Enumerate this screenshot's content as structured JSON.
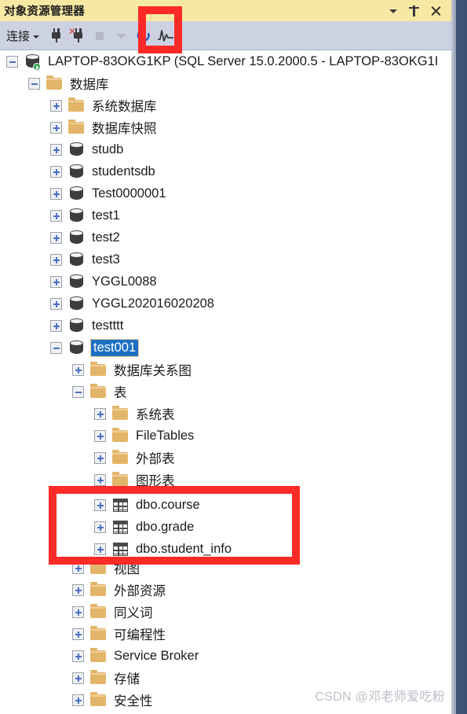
{
  "window": {
    "title": "对象资源管理器",
    "controls": [
      {
        "name": "dropdown",
        "icon": "caret-down-icon"
      },
      {
        "name": "pin",
        "icon": "pin-icon"
      },
      {
        "name": "close",
        "icon": "close-icon"
      }
    ]
  },
  "toolbar": {
    "connect_label": "连接",
    "buttons": [
      {
        "name": "connect",
        "icon": "plug-icon",
        "enabled": true
      },
      {
        "name": "disconnect",
        "icon": "plug-disconnect-icon",
        "enabled": true
      },
      {
        "name": "stop",
        "icon": "stop-square-icon",
        "enabled": false
      },
      {
        "name": "filter",
        "icon": "filter-caret-icon",
        "enabled": false
      },
      {
        "name": "refresh",
        "icon": "refresh-icon",
        "enabled": true
      },
      {
        "name": "activity-monitor",
        "icon": "activity-monitor-icon",
        "enabled": true
      }
    ]
  },
  "tree": {
    "nodes": [
      {
        "label": "LAPTOP-83OKG1KP (SQL Server 15.0.2000.5 - LAPTOP-83OKG1I",
        "indent": 0,
        "icon": "server-icon",
        "state": "minus",
        "selected": false
      },
      {
        "label": "数据库",
        "indent": 1,
        "icon": "folder-icon",
        "state": "minus",
        "selected": false
      },
      {
        "label": "系统数据库",
        "indent": 2,
        "icon": "folder-icon",
        "state": "plus",
        "selected": false
      },
      {
        "label": "数据库快照",
        "indent": 2,
        "icon": "folder-icon",
        "state": "plus",
        "selected": false
      },
      {
        "label": "studb",
        "indent": 2,
        "icon": "database-icon",
        "state": "plus",
        "selected": false
      },
      {
        "label": "studentsdb",
        "indent": 2,
        "icon": "database-icon",
        "state": "plus",
        "selected": false
      },
      {
        "label": "Test0000001",
        "indent": 2,
        "icon": "database-icon",
        "state": "plus",
        "selected": false
      },
      {
        "label": "test1",
        "indent": 2,
        "icon": "database-icon",
        "state": "plus",
        "selected": false
      },
      {
        "label": "test2",
        "indent": 2,
        "icon": "database-icon",
        "state": "plus",
        "selected": false
      },
      {
        "label": "test3",
        "indent": 2,
        "icon": "database-icon",
        "state": "plus",
        "selected": false
      },
      {
        "label": "YGGL0088",
        "indent": 2,
        "icon": "database-icon",
        "state": "plus",
        "selected": false
      },
      {
        "label": "YGGL202016020208",
        "indent": 2,
        "icon": "database-icon",
        "state": "plus",
        "selected": false
      },
      {
        "label": "testttt",
        "indent": 2,
        "icon": "database-icon",
        "state": "plus",
        "selected": false
      },
      {
        "label": "test001",
        "indent": 2,
        "icon": "database-icon",
        "state": "minus",
        "selected": true
      },
      {
        "label": "数据库关系图",
        "indent": 3,
        "icon": "folder-icon",
        "state": "plus",
        "selected": false
      },
      {
        "label": "表",
        "indent": 3,
        "icon": "folder-icon",
        "state": "minus",
        "selected": false
      },
      {
        "label": "系统表",
        "indent": 4,
        "icon": "folder-icon",
        "state": "plus",
        "selected": false
      },
      {
        "label": "FileTables",
        "indent": 4,
        "icon": "folder-icon",
        "state": "plus",
        "selected": false
      },
      {
        "label": "外部表",
        "indent": 4,
        "icon": "folder-icon",
        "state": "plus",
        "selected": false
      },
      {
        "label": "图形表",
        "indent": 4,
        "icon": "folder-icon",
        "state": "plus",
        "selected": false
      },
      {
        "label": "dbo.course",
        "indent": 4,
        "icon": "table-icon",
        "state": "plus",
        "selected": false
      },
      {
        "label": "dbo.grade",
        "indent": 4,
        "icon": "table-icon",
        "state": "plus",
        "selected": false
      },
      {
        "label": "dbo.student_info",
        "indent": 4,
        "icon": "table-icon",
        "state": "plus",
        "selected": false
      },
      {
        "label": "视图",
        "indent": 3,
        "icon": "folder-icon",
        "state": "plus",
        "selected": false
      },
      {
        "label": "外部资源",
        "indent": 3,
        "icon": "folder-icon",
        "state": "plus",
        "selected": false
      },
      {
        "label": "同义词",
        "indent": 3,
        "icon": "folder-icon",
        "state": "plus",
        "selected": false
      },
      {
        "label": "可编程性",
        "indent": 3,
        "icon": "folder-icon",
        "state": "plus",
        "selected": false
      },
      {
        "label": "Service Broker",
        "indent": 3,
        "icon": "folder-icon",
        "state": "plus",
        "selected": false
      },
      {
        "label": "存储",
        "indent": 3,
        "icon": "folder-icon",
        "state": "plus",
        "selected": false
      },
      {
        "label": "安全性",
        "indent": 3,
        "icon": "folder-icon",
        "state": "plus",
        "selected": false
      }
    ]
  },
  "annotations": [
    {
      "name": "refresh-highlight",
      "color": "#fc2b28"
    },
    {
      "name": "tables-highlight",
      "color": "#fc2b28"
    }
  ],
  "watermark": {
    "text": "CSDN @邓老师爱吃粉"
  }
}
